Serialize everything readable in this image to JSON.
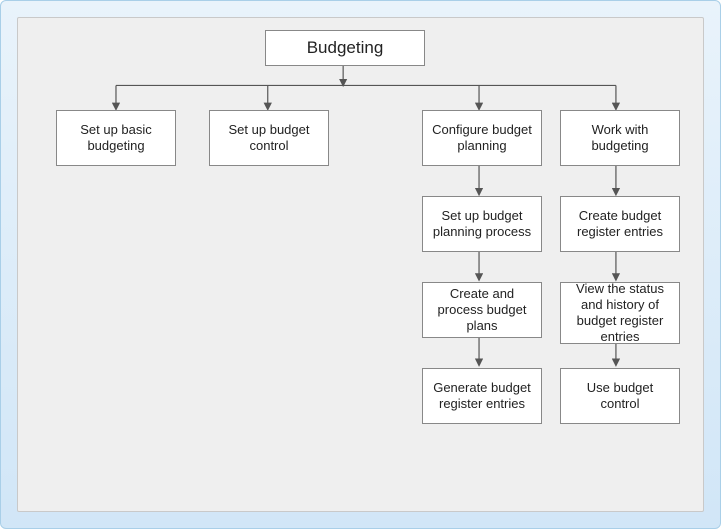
{
  "diagram": {
    "root": "Budgeting",
    "children": [
      {
        "label": "Set up basic budgeting"
      },
      {
        "label": "Set up budget control"
      },
      {
        "label": "Configure budget planning",
        "chain": [
          "Set up budget planning process",
          "Create and process budget plans",
          "Generate budget register entries"
        ]
      },
      {
        "label": "Work with budgeting",
        "chain": [
          "Create budget register entries",
          "View the status and history of budget register entries",
          "Use budget control"
        ]
      }
    ]
  }
}
